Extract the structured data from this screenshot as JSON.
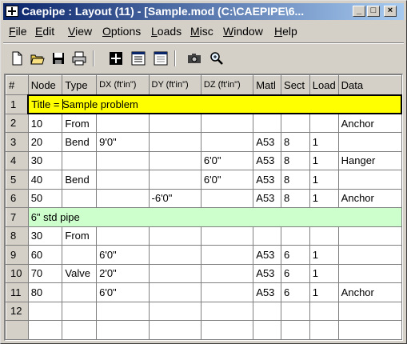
{
  "window": {
    "title": "Caepipe : Layout  (11)  -  [Sample.mod (C:\\CAEPIPE\\6..."
  },
  "titlebar_buttons": {
    "minimize": "_",
    "maximize": "□",
    "close": "×"
  },
  "menu": [
    {
      "label": "File",
      "underline": "F",
      "rest": "ile"
    },
    {
      "label": "Edit",
      "underline": "E",
      "rest": "dit"
    },
    {
      "label": "View",
      "underline": "V",
      "rest": "iew"
    },
    {
      "label": "Options",
      "underline": "O",
      "rest": "ptions"
    },
    {
      "label": "Loads",
      "underline": "L",
      "rest": "oads"
    },
    {
      "label": "Misc",
      "underline": "M",
      "rest": "isc"
    },
    {
      "label": "Window",
      "underline": "W",
      "rest": "indow"
    },
    {
      "label": "Help",
      "underline": "H",
      "rest": "elp"
    }
  ],
  "toolbar": [
    "new-file-icon",
    "open-folder-icon",
    "save-disk-icon",
    "print-icon",
    "graphics-window-icon",
    "list-window-icon",
    "layout-window-icon",
    "camera-icon",
    "zoom-icon"
  ],
  "grid": {
    "columns": [
      "#",
      "Node",
      "Type",
      "DX (ft'in\")",
      "DY (ft'in\")",
      "DZ (ft'in\")",
      "Matl",
      "Sect",
      "Load",
      "Data"
    ],
    "title_row": {
      "num": "1",
      "prefix": "Title = ",
      "first": "S",
      "rest": "ample problem"
    },
    "comment_row": {
      "num": "7",
      "text": "6\" std pipe"
    },
    "rows": [
      {
        "num": "2",
        "cells": [
          "10",
          "From",
          "",
          "",
          "",
          "",
          "",
          "",
          "Anchor"
        ]
      },
      {
        "num": "3",
        "cells": [
          "20",
          "Bend",
          "9'0\"",
          "",
          "",
          "A53",
          "8",
          "1",
          ""
        ]
      },
      {
        "num": "4",
        "cells": [
          "30",
          "",
          "",
          "",
          "6'0\"",
          "A53",
          "8",
          "1",
          "Hanger"
        ]
      },
      {
        "num": "5",
        "cells": [
          "40",
          "Bend",
          "",
          "",
          "6'0\"",
          "A53",
          "8",
          "1",
          ""
        ]
      },
      {
        "num": "6",
        "cells": [
          "50",
          "",
          "",
          "-6'0\"",
          "",
          "A53",
          "8",
          "1",
          "Anchor"
        ]
      },
      {
        "num": "8",
        "cells": [
          "30",
          "From",
          "",
          "",
          "",
          "",
          "",
          "",
          ""
        ]
      },
      {
        "num": "9",
        "cells": [
          "60",
          "",
          "6'0\"",
          "",
          "",
          "A53",
          "6",
          "1",
          ""
        ]
      },
      {
        "num": "10",
        "cells": [
          "70",
          "Valve",
          "2'0\"",
          "",
          "",
          "A53",
          "6",
          "1",
          ""
        ]
      },
      {
        "num": "11",
        "cells": [
          "80",
          "",
          "6'0\"",
          "",
          "",
          "A53",
          "6",
          "1",
          "Anchor"
        ]
      },
      {
        "num": "12",
        "cells": [
          "",
          "",
          "",
          "",
          "",
          "",
          "",
          "",
          ""
        ]
      },
      {
        "num": "",
        "cells": [
          "",
          "",
          "",
          "",
          "",
          "",
          "",
          "",
          ""
        ]
      }
    ]
  }
}
